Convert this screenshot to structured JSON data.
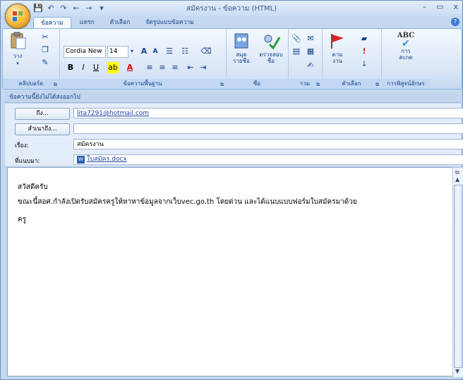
{
  "window": {
    "title": "สมัครงาน - ข้อความ (HTML)",
    "minimize": "–",
    "maximize": "▭",
    "close": "x"
  },
  "qat": {
    "save": "💾",
    "undo": "↶",
    "redo": "↷",
    "prev": "←",
    "next": "→",
    "more": "▾"
  },
  "tabs": [
    {
      "label": "ข้อความ",
      "active": true
    },
    {
      "label": "แทรก",
      "active": false
    },
    {
      "label": "ตัวเลือก",
      "active": false
    },
    {
      "label": "จัดรูปแบบข้อความ",
      "active": false
    }
  ],
  "help": "?",
  "ribbon": {
    "clipboard": {
      "label": "คลิปบอร์ด",
      "paste": "วาง"
    },
    "basic_text": {
      "label": "ข้อความพื้นฐาน",
      "font": "Cordia New",
      "size": "14"
    },
    "names": {
      "label": "ชื่อ",
      "address_book": "สมุด\nรายชื่อ",
      "check_names": "ตรวจสอบ\nชื่อ"
    },
    "include": {
      "label": "รวม"
    },
    "options": {
      "label": "ตัวเลือก",
      "follow_up": "ตาม\nงาน"
    },
    "proofing": {
      "label": "การพิสูจน์อักษร",
      "spelling": "การ\nสะกด",
      "abc": "ABC"
    }
  },
  "infobar": "ข้อความนี้ยังไม่ได้ส่งออกไป",
  "header": {
    "to_button": "ถึง...",
    "to_value": "lita7291@hotmail.com",
    "cc_button": "สำเนาถึง...",
    "cc_value": "",
    "subject_label": "เรื่อง:",
    "subject_value": "สมัครงาน",
    "attach_label": "ที่แนบมา:",
    "attach_value": "ใบสมัคร.docx"
  },
  "body": {
    "line1": "สวัสดีครับ",
    "line2": "ขณะนี้สอศ.กำลังเปิดรับสมัครครูให้หาหาข้อมูลจากเว็บvec.go.th โดยด่วน และได้แนบแบบฟอร์มใบสมัครมาด้วย",
    "line3": "ครู"
  },
  "colors": {
    "highlight": "#ffff00",
    "font_color": "#ff0000",
    "accent": "#15428b"
  }
}
